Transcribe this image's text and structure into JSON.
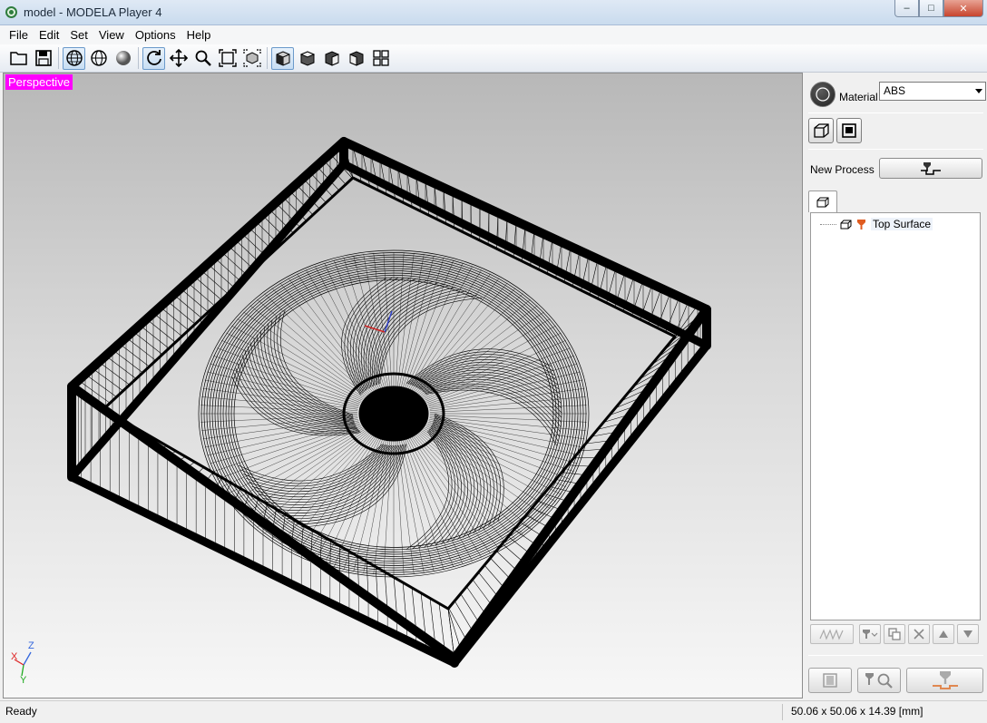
{
  "window": {
    "title": "model - MODELA Player 4",
    "controls": {
      "minimize": "–",
      "maximize": "□",
      "close": "✕"
    }
  },
  "menu": [
    "File",
    "Edit",
    "Set",
    "View",
    "Options",
    "Help"
  ],
  "toolbar": {
    "groups": [
      [
        "open-folder-icon",
        "save-icon"
      ],
      [
        "wireframe-sphere-icon",
        "outline-sphere-icon",
        "shaded-sphere-icon"
      ],
      [
        "rotate-icon",
        "pan-icon",
        "zoom-icon",
        "fit-view-icon",
        "zoom-box-icon"
      ],
      [
        "front-view-icon",
        "top-view-icon",
        "right-view-icon",
        "left-view-icon",
        "four-views-icon"
      ]
    ]
  },
  "viewport": {
    "label": "Perspective",
    "label_color": "#ff00ff",
    "axes": {
      "z": "Z",
      "x": "X",
      "y": "Y"
    }
  },
  "panel": {
    "material_label": "Material",
    "material_value": "ABS",
    "new_process_label": "New Process",
    "process_tree": [
      {
        "label": "Top Surface",
        "icon": "tool-icon"
      }
    ]
  },
  "status": {
    "text": "Ready",
    "dimensions": "50.06 x 50.06 x 14.39 [mm]"
  },
  "colors": {
    "view_label_bg": "#ff00ff",
    "selected_tool": "#c8def3"
  }
}
